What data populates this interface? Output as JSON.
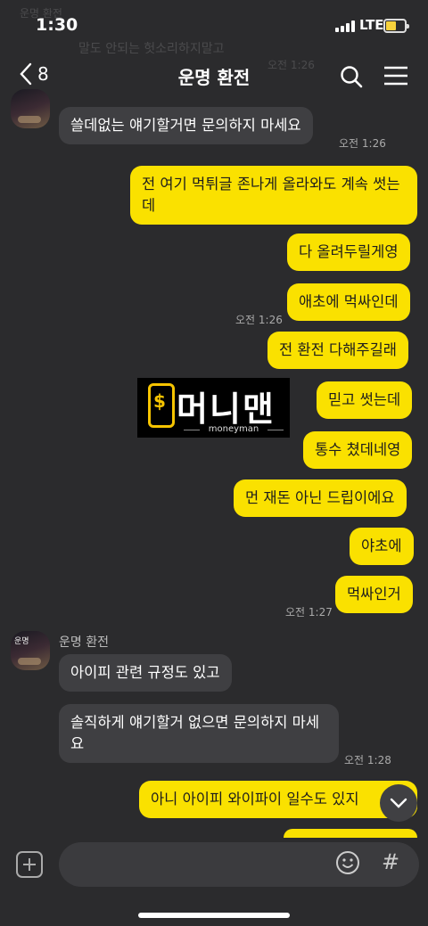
{
  "status_bar": {
    "time": "1:30",
    "network": "LTE"
  },
  "header": {
    "back_count": "8",
    "title": "운명 환전"
  },
  "faded_top": {
    "line1": "운명 환전",
    "line2": "말도 안되는 헛소리하지말고",
    "line3": "오전 1:26"
  },
  "messages": {
    "m1": {
      "sender": "운명 환전",
      "text": "쓸데없는 얘기할거면 문의하지 마세요",
      "time": "오전 1:26"
    },
    "m2": {
      "text": "전 여기 먹튀글 존나게 올라와도 계속 썻는데"
    },
    "m3": {
      "text": "다 올려두릴게영"
    },
    "m4": {
      "text": "애초에 먹싸인데",
      "time": "오전 1:26"
    },
    "m5": {
      "text": "전 환전 다해주길래"
    },
    "m6": {
      "text": "믿고 썻는데"
    },
    "m7": {
      "text": "통수 쳤데네영"
    },
    "m8": {
      "text": "먼 재돈 아닌 드립이에요"
    },
    "m9": {
      "text": "야초에"
    },
    "m10": {
      "text": "먹싸인거",
      "time": "오전 1:27"
    },
    "m11": {
      "sender": "운명 환전",
      "text": "아이피 관련 규정도 있고"
    },
    "m12": {
      "text": "솔직하게 얘기할거 없으면 문의하지 마세요",
      "time": "오전 1:28"
    },
    "m13": {
      "text": "아니 아이피 와이파이 일수도 있지"
    }
  },
  "avatar_text": "운명",
  "watermark": {
    "brand": "머니맨",
    "sub": "moneyman",
    "symbol": "$"
  },
  "input": {
    "placeholder": ""
  },
  "colors": {
    "background": "#2b2b2d",
    "incoming": "#3f3f42",
    "outgoing": "#fae100"
  }
}
